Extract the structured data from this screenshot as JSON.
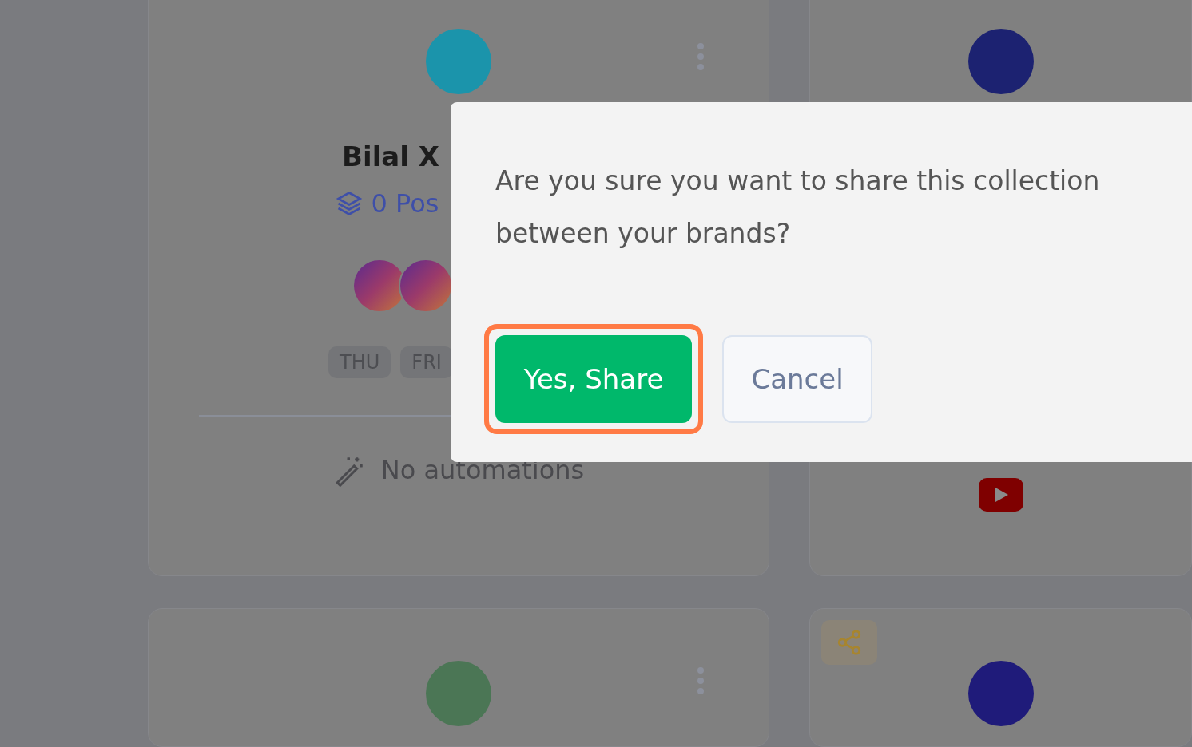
{
  "cards": [
    {
      "avatar": {
        "color": "#1b94ab"
      },
      "menu": true,
      "name": "Bilal X",
      "posts": "0 Pos",
      "accounts": [
        {
          "kind": "gradient"
        },
        {
          "kind": "gradient"
        }
      ],
      "days": [
        "THU",
        "FRI"
      ],
      "automation": "No automations"
    },
    {
      "avatar": {
        "color": "#1c2271"
      },
      "video_icon": true
    },
    {
      "avatar": {
        "color": "#4b7655"
      },
      "menu": true
    },
    {
      "avatar": {
        "color": "#1f1b7a"
      },
      "shared": true
    }
  ],
  "dialog": {
    "message": "Are you sure you want to share this collection between your brands?",
    "buttons": [
      {
        "label": "Yes, Share",
        "kind": "primary",
        "highlighted": true
      },
      {
        "label": "Cancel",
        "kind": "secondary",
        "highlighted": false
      }
    ]
  }
}
